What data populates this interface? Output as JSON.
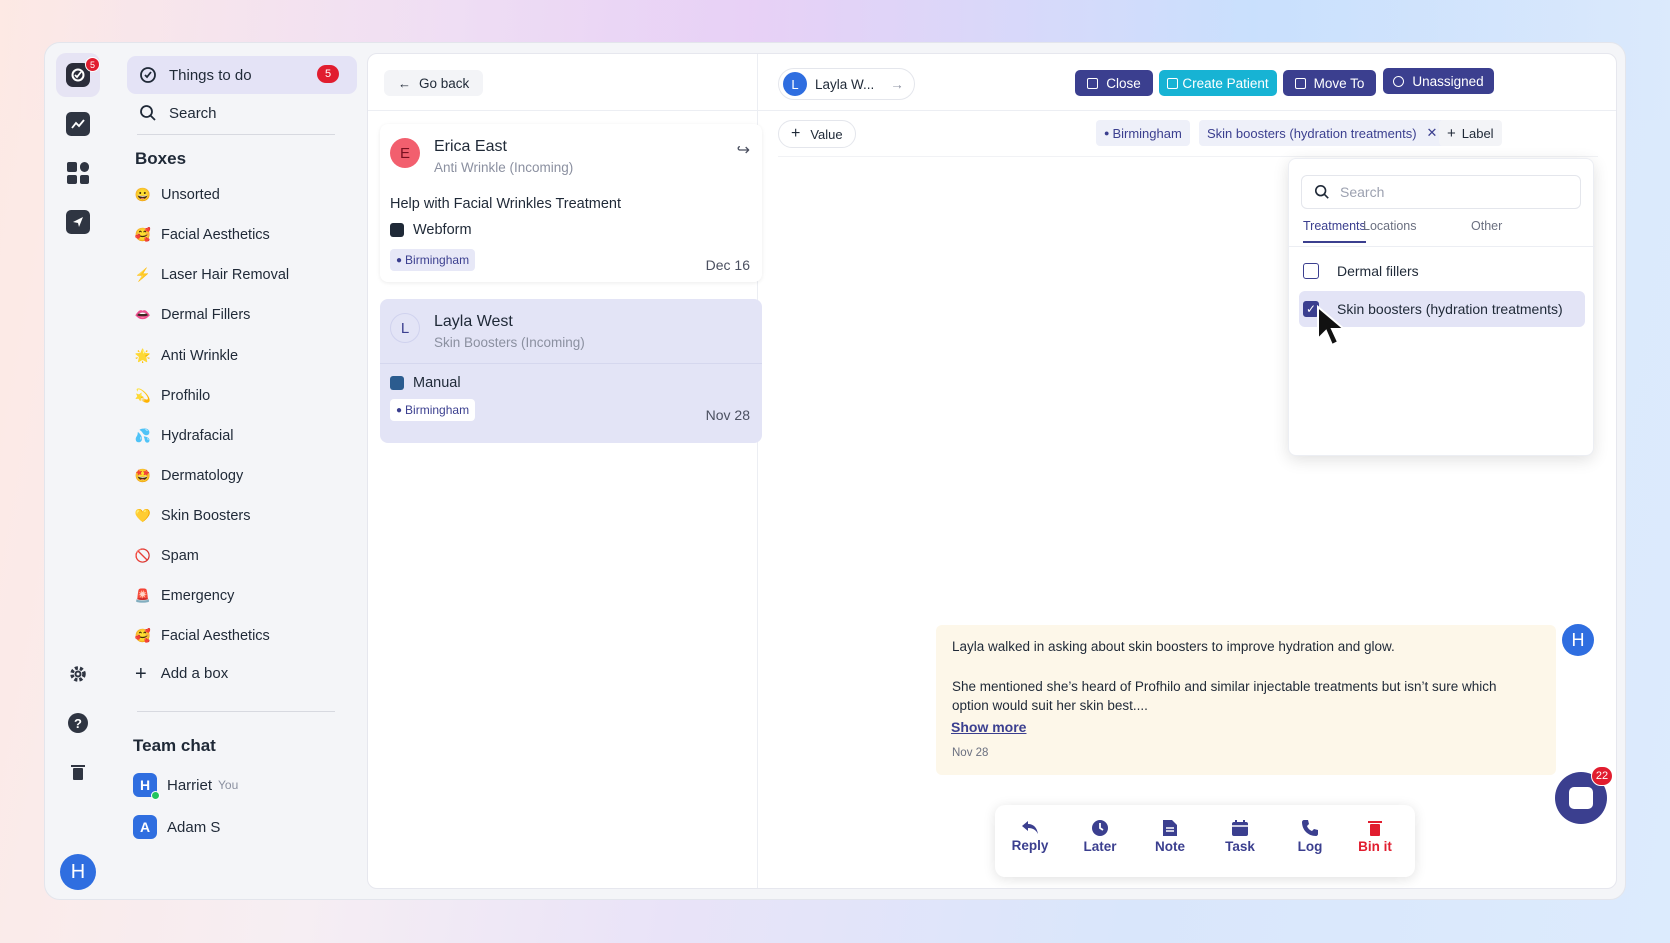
{
  "nav": {
    "logo_badge": "5",
    "things_to_do_label": "Things to do",
    "things_to_do_count": "5",
    "search_label": "Search",
    "user_initial": "H"
  },
  "boxes": {
    "heading": "Boxes",
    "items": [
      {
        "emoji": "😀",
        "label": "Unsorted"
      },
      {
        "emoji": "🥰",
        "label": "Facial Aesthetics"
      },
      {
        "emoji": "⚡",
        "label": "Laser Hair Removal"
      },
      {
        "emoji": "👄",
        "label": "Dermal Fillers"
      },
      {
        "emoji": "🌟",
        "label": "Anti Wrinkle"
      },
      {
        "emoji": "💫",
        "label": "Profhilo"
      },
      {
        "emoji": "💦",
        "label": "Hydrafacial"
      },
      {
        "emoji": "🤩",
        "label": "Dermatology"
      },
      {
        "emoji": "💛",
        "label": "Skin Boosters"
      },
      {
        "emoji": "🚫",
        "label": "Spam"
      },
      {
        "emoji": "🚨",
        "label": "Emergency"
      },
      {
        "emoji": "🥰",
        "label": "Facial Aesthetics"
      }
    ],
    "add_label": "Add a box"
  },
  "team_chat": {
    "heading": "Team chat",
    "users": [
      {
        "initial": "H",
        "name": "Harriet",
        "you": "You"
      },
      {
        "initial": "A",
        "name": "Adam S",
        "you": ""
      }
    ]
  },
  "list": {
    "go_back": "Go back",
    "cards": [
      {
        "initial": "E",
        "name": "Erica East",
        "subtitle": "Anti Wrinkle (Incoming)",
        "description": "Help with Facial Wrinkles Treatment",
        "source": "Webform",
        "location": "Birmingham",
        "date": "Dec 16"
      },
      {
        "initial": "L",
        "name": "Layla West",
        "subtitle": "Skin Boosters (Incoming)",
        "description": "",
        "source": "Manual",
        "location": "Birmingham",
        "date": "Nov 28"
      }
    ]
  },
  "detail": {
    "patient_initial": "L",
    "patient_name": "Layla W...",
    "buttons": {
      "close": "Close",
      "create_patient": "Create Patient",
      "move_to": "Move To",
      "unassigned": "Unassigned"
    },
    "value_label": "Value",
    "labels": {
      "location": "Birmingham",
      "treatment": "Skin boosters (hydration treatments)",
      "add_label": "Label"
    },
    "colors": {
      "primary": "#3b3f8f",
      "teal": "#17b3d4"
    }
  },
  "dropdown": {
    "search_placeholder": "Search",
    "tabs": [
      "Treatments",
      "Locations",
      "Other"
    ],
    "options": [
      {
        "label": "Dermal fillers",
        "checked": false
      },
      {
        "label": "Skin boosters (hydration treatments)",
        "checked": true
      }
    ]
  },
  "note": {
    "author_initial": "H",
    "line1": "Layla walked in asking about skin boosters to improve hydration and glow.",
    "line2": "She mentioned she’s heard of Profhilo and similar injectable treatments but isn’t sure which",
    "line3": "option would suit her skin best....",
    "show_more": "Show more",
    "date": "Nov 28"
  },
  "actions": [
    "Reply",
    "Later",
    "Note",
    "Task",
    "Log",
    "Bin it"
  ],
  "chat_fab_count": "22"
}
